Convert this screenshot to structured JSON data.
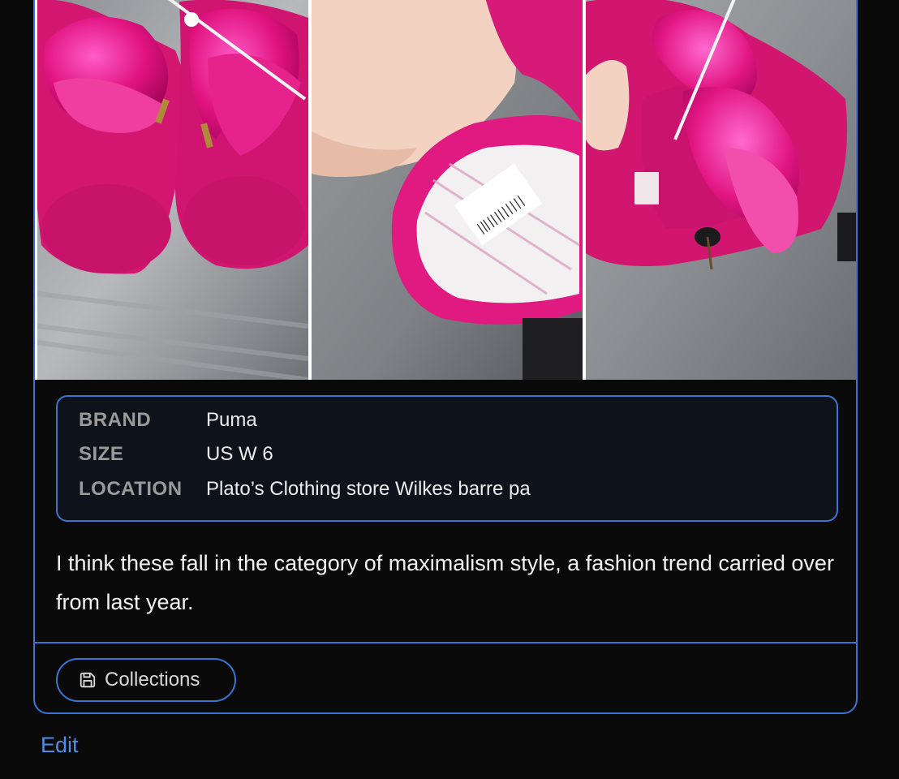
{
  "gallery": {
    "photos": [
      {
        "description_icon": "shoes-top-view-photo"
      },
      {
        "description_icon": "shoe-inside-label-photo"
      },
      {
        "description_icon": "shoes-side-view-photo"
      }
    ]
  },
  "details": {
    "brand_label": "BRAND",
    "brand_value": "Puma",
    "size_label": "SIZE",
    "size_value": "US W 6",
    "location_label": "LOCATION",
    "location_value": "Plato’s Clothing store Wilkes barre pa"
  },
  "description": "I think these fall in the category of maximalism style, a fashion trend carried over from last year.",
  "actions": {
    "collections_label": "Collections",
    "edit_label": "Edit"
  },
  "colors": {
    "accent": "#3a74d0",
    "link": "#4c8de6",
    "background": "#0a0a0a",
    "panel": "#0e131b"
  }
}
